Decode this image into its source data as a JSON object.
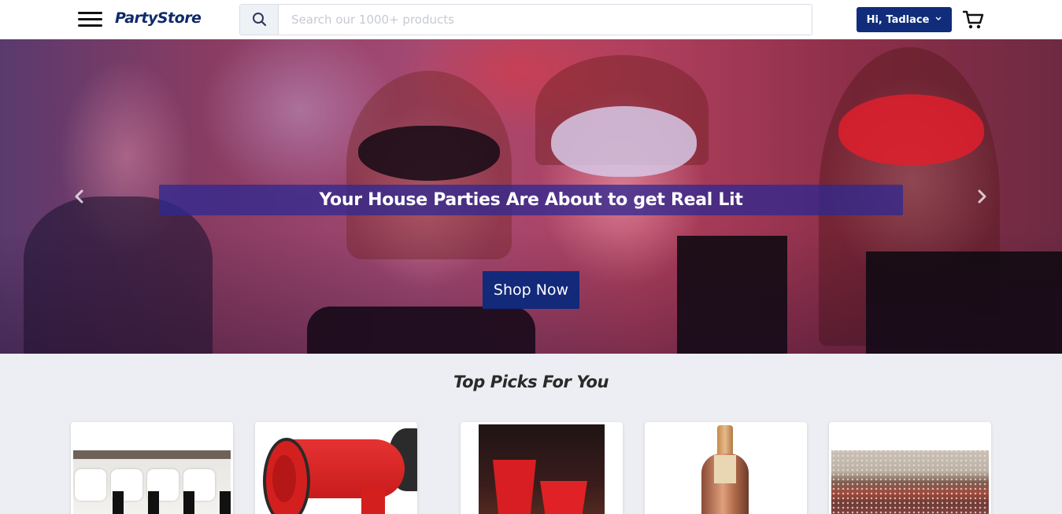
{
  "header": {
    "brand": "PartyStore",
    "search_placeholder": "Search our 1000+ products",
    "user_greeting": "Hi, Tadlace",
    "icons": [
      "menu-icon",
      "search-icon",
      "chevron-down-icon",
      "cart-icon"
    ]
  },
  "hero": {
    "headline": "Your House Parties Are About to get Real Lit",
    "cta_label": "Shop Now",
    "icons": [
      "arrow-left-icon",
      "arrow-right-icon"
    ]
  },
  "top_picks": {
    "title": "Top Picks For You",
    "products": [
      {
        "image": "pillows-and-gift-bags"
      },
      {
        "image": "red-megaphone"
      },
      {
        "image": "red-party-cups"
      },
      {
        "image": "champagne-bottle"
      },
      {
        "image": "party-crowd"
      }
    ]
  },
  "colors": {
    "brand": "#0f2a6b",
    "primary_button": "#102c7a",
    "page_background": "#eceef3",
    "headline_band": "#2d2891"
  }
}
